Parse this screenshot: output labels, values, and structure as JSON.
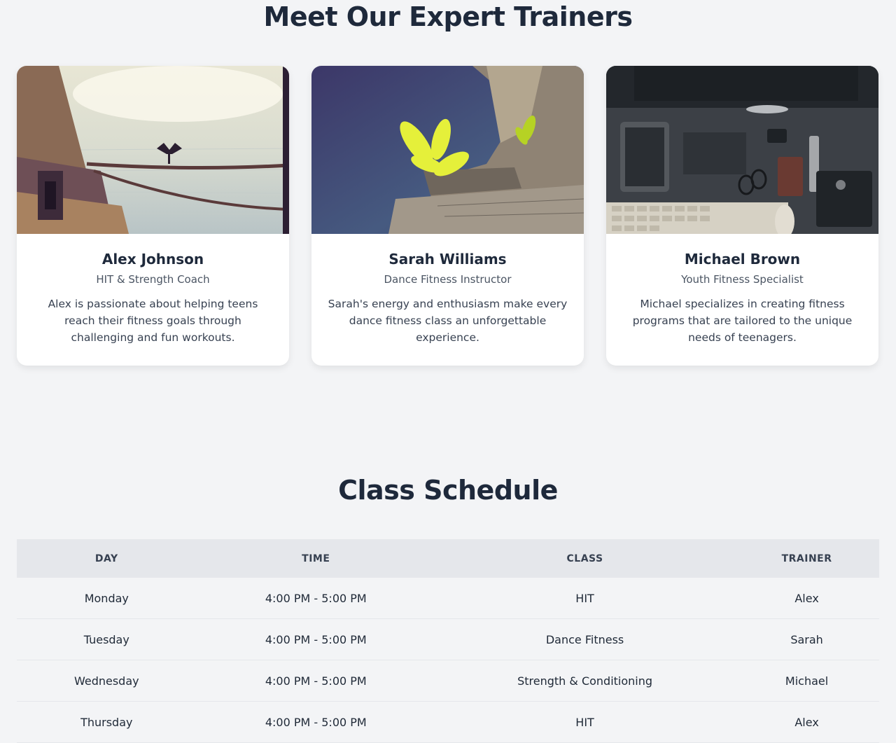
{
  "trainers": {
    "title": "Meet Our Expert Trainers",
    "cards": [
      {
        "name": "Alex Johnson",
        "role": "HIT & Strength Coach",
        "bio": "Alex is passionate about helping teens reach their fitness goals through challenging and fun workouts.",
        "photo": "bird-on-lake-photo"
      },
      {
        "name": "Sarah Williams",
        "role": "Dance Fitness Instructor",
        "bio": "Sarah's energy and enthusiasm make every dance fitness class an unforgettable experience.",
        "photo": "plant-on-rock-photo"
      },
      {
        "name": "Michael Brown",
        "role": "Youth Fitness Specialist",
        "bio": "Michael specializes in creating fitness programs that are tailored to the unique needs of teenagers.",
        "photo": "desk-gadgets-photo"
      }
    ]
  },
  "schedule": {
    "title": "Class Schedule",
    "headers": [
      "Day",
      "Time",
      "Class",
      "Trainer"
    ],
    "rows": [
      [
        "Monday",
        "4:00 PM - 5:00 PM",
        "HIT",
        "Alex"
      ],
      [
        "Tuesday",
        "4:00 PM - 5:00 PM",
        "Dance Fitness",
        "Sarah"
      ],
      [
        "Wednesday",
        "4:00 PM - 5:00 PM",
        "Strength & Conditioning",
        "Michael"
      ],
      [
        "Thursday",
        "4:00 PM - 5:00 PM",
        "HIT",
        "Alex"
      ]
    ]
  }
}
